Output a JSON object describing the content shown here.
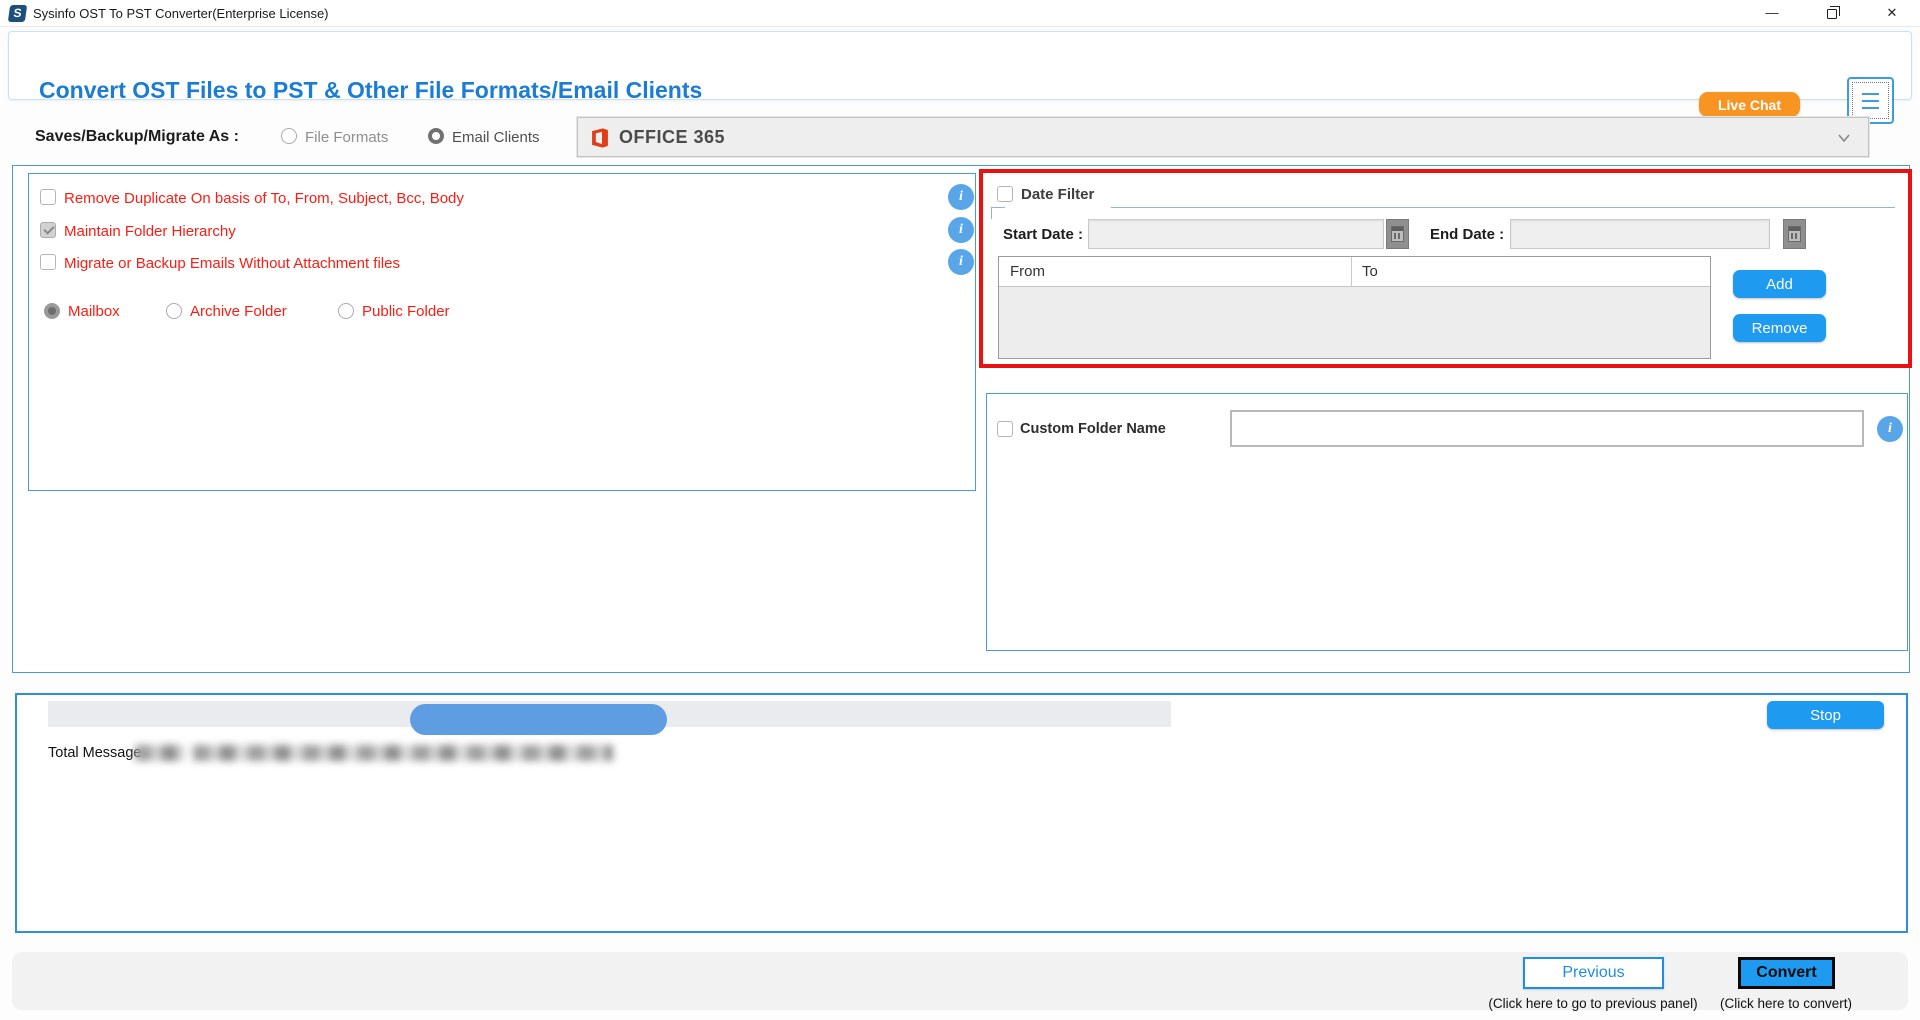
{
  "window": {
    "title": "Sysinfo OST To PST Converter(Enterprise License)",
    "minimize_glyph": "—"
  },
  "header": {
    "title": "Convert OST Files to PST & Other File Formats/Email Clients",
    "live_chat_label": "Live Chat"
  },
  "options_bar": {
    "label": "Saves/Backup/Migrate As :",
    "file_formats_label": "File Formats",
    "email_clients_label": "Email Clients",
    "email_clients_selected": true,
    "dropdown_value": "OFFICE 365"
  },
  "left_panel": {
    "checkboxes": [
      {
        "label": "Remove Duplicate On basis of To, From, Subject, Bcc, Body",
        "checked": false
      },
      {
        "label": "Maintain Folder Hierarchy",
        "checked": true,
        "disabled": true
      },
      {
        "label": "Migrate or Backup Emails Without Attachment files",
        "checked": false
      }
    ],
    "radios": [
      {
        "label": "Mailbox",
        "selected": true
      },
      {
        "label": "Archive Folder",
        "selected": false
      },
      {
        "label": "Public Folder",
        "selected": false
      }
    ]
  },
  "date_filter": {
    "title": "Date Filter",
    "enabled": false,
    "start_date_label": "Start Date :",
    "start_date_value": "",
    "end_date_label": "End Date :",
    "end_date_value": "",
    "table_columns": [
      "From",
      "To"
    ],
    "add_label": "Add",
    "remove_label": "Remove"
  },
  "custom_folder": {
    "label": "Custom Folder Name",
    "enabled": false,
    "value": ""
  },
  "progress": {
    "stop_label": "Stop",
    "total_message_label": "Total Message",
    "detail_redacted": true
  },
  "footer": {
    "previous_label": "Previous",
    "previous_caption": "(Click here to go to previous panel)",
    "convert_label": "Convert",
    "convert_caption": "(Click here to convert)"
  },
  "colors": {
    "accent_blue": "#1e9af1",
    "header_title_blue": "#1b7cd5",
    "panel_border_blue": "#4d9ad8",
    "highlight_red_border": "#e91212",
    "option_label_red": "#fb1d14",
    "live_chat_orange": "#f89522",
    "progress_fill_blue": "#5f9de2",
    "office_icon_orange": "#e03e19"
  }
}
